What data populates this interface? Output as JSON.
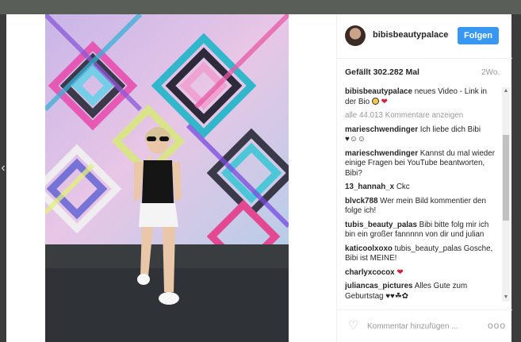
{
  "post": {
    "username": "bibisbeautypalace",
    "follow_label": "Folgen",
    "likes_text": "Gefällt 302.282 Mal",
    "time": "2Wo.",
    "caption_user": "bibisbeautypalace",
    "caption_text": "neues Video - Link in der Bio",
    "load_more": "alle 44.013 Kommentare anzeigen",
    "comment_placeholder": "Kommentar hinzufügen ...",
    "more_label": "ooo"
  },
  "comments": [
    {
      "user": "marieschwendinger",
      "text": "Ich liebe dich Bibi"
    },
    {
      "user": "marieschwendinger",
      "text": "Kannst du mal wieder einige Fragen bei YouTube beantworten, Bibi?"
    },
    {
      "user": "13_hannah_x",
      "text": "Ckc"
    },
    {
      "user": "blvck788",
      "text": "Wer mein Bild kommentier den folge ich!"
    },
    {
      "user": "tubis_beauty_palas",
      "text": "Bibi bitte folg mir ich bin ein großer fannnnn von dir und julian"
    },
    {
      "user": "katicoolxoxo",
      "text": "tubis_beauty_palas Gosche, Bibi ist MEINE!"
    },
    {
      "user": "charlyxcocox",
      "text": ""
    },
    {
      "user": "juliancas_pictures",
      "text": "Alles Gute zum Geburtstag"
    }
  ],
  "icons": {
    "follow_bg": "#3897f0",
    "heart": "heart-outline-icon",
    "more": "more-options-icon",
    "nav": "chevron-left-icon"
  }
}
